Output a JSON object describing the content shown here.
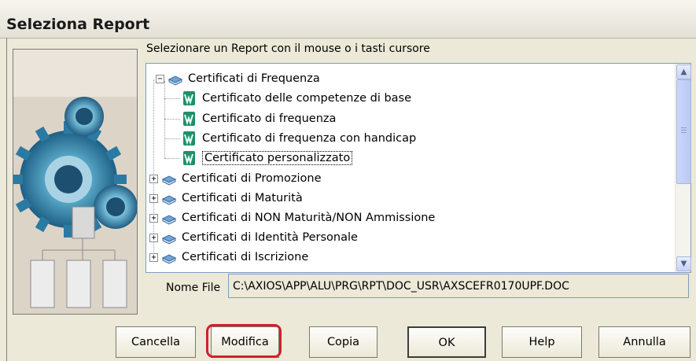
{
  "window": {
    "title": "Seleziona Report"
  },
  "instruction": "Selezionare un Report con il mouse o i tasti cursore",
  "tree": {
    "groups": [
      {
        "label": "Certificati di Frequenza",
        "expander": "−",
        "expanded": true
      },
      {
        "label": "Certificati di Promozione",
        "expander": "+",
        "expanded": false
      },
      {
        "label": "Certificati di Maturità",
        "expander": "+",
        "expanded": false
      },
      {
        "label": "Certificati di NON Maturità/NON Ammissione",
        "expander": "+",
        "expanded": false
      },
      {
        "label": "Certificati di Identità Personale",
        "expander": "+",
        "expanded": false
      },
      {
        "label": "Certificati di Iscrizione",
        "expander": "+",
        "expanded": false
      }
    ],
    "children": [
      {
        "label": "Certificato delle competenze di base",
        "icon": "word-document-icon"
      },
      {
        "label": "Certificato di frequenza",
        "icon": "word-document-icon"
      },
      {
        "label": "Certificato di frequenza con handicap",
        "icon": "word-document-icon"
      },
      {
        "label": "Certificato personalizzato",
        "icon": "word-document-icon",
        "selected": true
      }
    ],
    "scrollbar": {
      "up": "▲",
      "down": "▼",
      "grip": "≡"
    }
  },
  "file": {
    "label": "Nome File",
    "value": "C:\\AXIOS\\APP\\ALU\\PRG\\RPT\\DOC_USR\\AXSCEFR0170UPF.DOC"
  },
  "buttons": {
    "cancella": "Cancella",
    "modifica": "Modifica",
    "copia": "Copia",
    "ok": "OK",
    "help": "Help",
    "annulla": "Annulla"
  },
  "colors": {
    "highlight": "#d1202b",
    "tree_border": "#7f9db9",
    "dialog_bg": "#ece9d8"
  }
}
